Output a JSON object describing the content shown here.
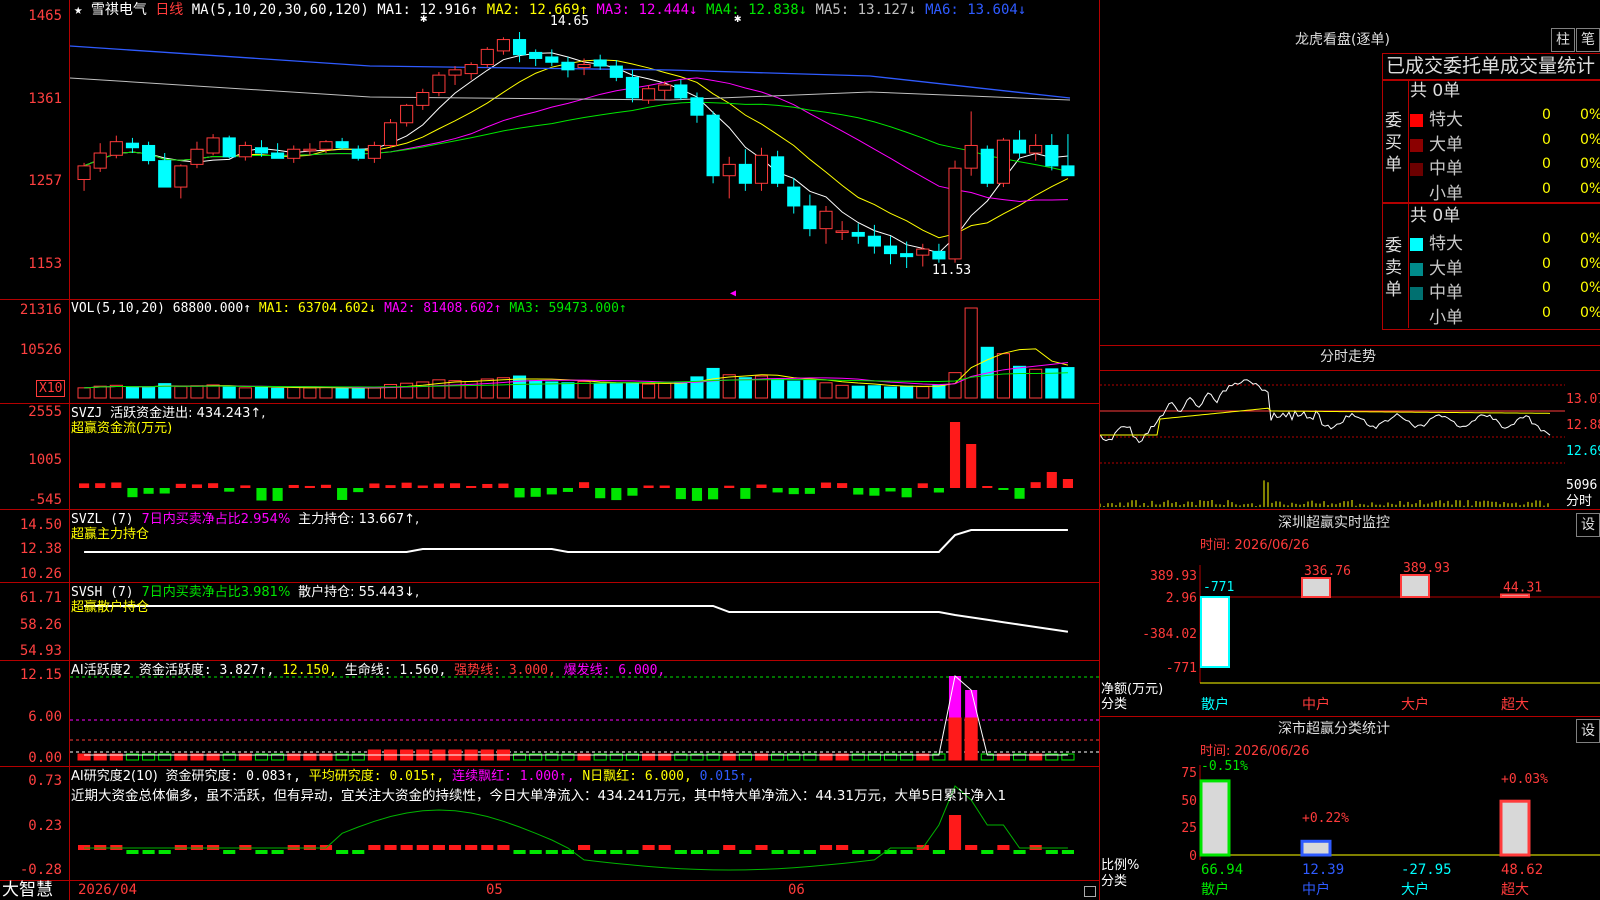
{
  "app": {
    "brand": "大智慧"
  },
  "stock": {
    "star": "★",
    "name": "雪祺电气",
    "period": "日线"
  },
  "main_chart": {
    "ma_header": "MA(5,10,20,30,60,120)",
    "ma_items": [
      {
        "label": "MA1: 12.916↑",
        "color": "#ffffff"
      },
      {
        "label": "MA2: 12.669↑",
        "color": "#ffff00"
      },
      {
        "label": "MA3: 12.444↓",
        "color": "#ff00ff"
      },
      {
        "label": "MA4: 12.838↓",
        "color": "#00e600"
      },
      {
        "label": "MA5: 13.127↓",
        "color": "#c0c0c0"
      },
      {
        "label": "MA6: 13.604↓",
        "color": "#2f5bff"
      }
    ],
    "y_ticks": [
      "1465",
      "1361",
      "1257",
      "1153"
    ],
    "high_label": "14.65",
    "low_label": "11.53",
    "candles": [
      [
        12.7,
        12.92,
        12.55,
        12.88
      ],
      [
        12.85,
        13.18,
        12.8,
        13.05
      ],
      [
        13.02,
        13.28,
        12.98,
        13.2
      ],
      [
        13.18,
        13.25,
        13.05,
        13.12
      ],
      [
        13.15,
        13.2,
        12.9,
        12.95
      ],
      [
        12.95,
        13.05,
        12.65,
        12.6
      ],
      [
        12.6,
        12.9,
        12.45,
        12.88
      ],
      [
        12.9,
        13.2,
        12.85,
        13.1
      ],
      [
        13.05,
        13.3,
        13.02,
        13.25
      ],
      [
        13.25,
        13.28,
        12.98,
        13.0
      ],
      [
        13.0,
        13.2,
        12.95,
        13.15
      ],
      [
        13.12,
        13.22,
        13.0,
        13.05
      ],
      [
        13.05,
        13.18,
        12.98,
        12.98
      ],
      [
        12.98,
        13.15,
        12.92,
        13.1
      ],
      [
        13.08,
        13.18,
        13.02,
        13.1
      ],
      [
        13.1,
        13.22,
        13.05,
        13.2
      ],
      [
        13.2,
        13.25,
        13.1,
        13.12
      ],
      [
        13.1,
        13.15,
        12.95,
        12.98
      ],
      [
        12.98,
        13.2,
        12.92,
        13.15
      ],
      [
        13.15,
        13.5,
        13.12,
        13.45
      ],
      [
        13.45,
        13.7,
        13.4,
        13.68
      ],
      [
        13.68,
        13.9,
        13.62,
        13.85
      ],
      [
        13.85,
        14.12,
        13.8,
        14.08
      ],
      [
        14.08,
        14.2,
        13.95,
        14.15
      ],
      [
        14.1,
        14.25,
        14.02,
        14.22
      ],
      [
        14.22,
        14.45,
        14.18,
        14.42
      ],
      [
        14.4,
        14.58,
        14.35,
        14.55
      ],
      [
        14.55,
        14.65,
        14.25,
        14.35
      ],
      [
        14.38,
        14.42,
        14.2,
        14.3
      ],
      [
        14.32,
        14.42,
        14.2,
        14.25
      ],
      [
        14.25,
        14.32,
        14.05,
        14.15
      ],
      [
        14.18,
        14.3,
        14.08,
        14.22
      ],
      [
        14.28,
        14.35,
        14.15,
        14.2
      ],
      [
        14.2,
        14.28,
        14.0,
        14.05
      ],
      [
        14.05,
        14.15,
        13.72,
        13.78
      ],
      [
        13.75,
        13.95,
        13.7,
        13.9
      ],
      [
        13.88,
        14.0,
        13.75,
        13.95
      ],
      [
        13.95,
        14.02,
        13.75,
        13.78
      ],
      [
        13.78,
        13.85,
        13.45,
        13.55
      ],
      [
        13.55,
        13.6,
        12.65,
        12.75
      ],
      [
        12.75,
        13.0,
        12.45,
        12.9
      ],
      [
        12.9,
        13.1,
        12.55,
        12.65
      ],
      [
        12.65,
        13.12,
        12.55,
        13.02
      ],
      [
        13.0,
        13.08,
        12.6,
        12.65
      ],
      [
        12.6,
        12.72,
        12.25,
        12.35
      ],
      [
        12.35,
        12.5,
        11.95,
        12.05
      ],
      [
        12.05,
        12.35,
        11.85,
        12.28
      ],
      [
        12.0,
        12.15,
        11.9,
        12.02
      ],
      [
        12.0,
        12.12,
        11.85,
        11.95
      ],
      [
        11.95,
        12.1,
        11.72,
        11.82
      ],
      [
        11.82,
        11.95,
        11.58,
        11.72
      ],
      [
        11.72,
        11.88,
        11.53,
        11.68
      ],
      [
        11.7,
        11.85,
        11.55,
        11.78
      ],
      [
        11.75,
        11.85,
        11.6,
        11.65
      ],
      [
        11.65,
        12.95,
        11.6,
        12.85
      ],
      [
        12.85,
        13.6,
        12.75,
        13.15
      ],
      [
        13.1,
        13.15,
        12.6,
        12.65
      ],
      [
        12.65,
        13.25,
        12.6,
        13.22
      ],
      [
        13.22,
        13.35,
        12.98,
        13.05
      ],
      [
        13.05,
        13.3,
        12.95,
        13.15
      ],
      [
        13.15,
        13.3,
        12.82,
        12.88
      ],
      [
        12.88,
        13.3,
        12.8,
        12.75
      ]
    ]
  },
  "vol_pane": {
    "header": "VOL(5,10,20)",
    "items": [
      {
        "label": "68800.000↑",
        "color": "#ffffff"
      },
      {
        "label": "MA1: 63704.602↓",
        "color": "#ffff00"
      },
      {
        "label": "MA2: 81408.602↑",
        "color": "#ff00ff"
      },
      {
        "label": "MA3: 59473.000↑",
        "color": "#00e600"
      }
    ],
    "y_ticks": [
      "21316",
      "10526"
    ],
    "unit": "X10",
    "values": [
      2.4,
      2.8,
      3.0,
      2.6,
      2.5,
      3.4,
      2.7,
      2.9,
      3.1,
      2.6,
      2.4,
      2.5,
      2.3,
      2.6,
      2.4,
      2.5,
      2.3,
      2.2,
      2.4,
      3.2,
      3.5,
      3.8,
      4.3,
      4.1,
      3.9,
      4.5,
      4.8,
      5.2,
      4.1,
      3.8,
      3.6,
      3.9,
      3.5,
      3.4,
      3.6,
      3.3,
      3.5,
      3.8,
      5.0,
      7.0,
      5.5,
      4.8,
      5.2,
      4.4,
      4.0,
      4.3,
      3.6,
      3.0,
      2.8,
      2.9,
      2.6,
      2.8,
      2.7,
      3.1,
      6.0,
      21.3,
      12.0,
      10.5,
      7.5,
      6.8,
      6.9,
      7.2
    ]
  },
  "svzj_pane": {
    "title": "SVZJ",
    "item": "活跃资金进出: 434.243↑,",
    "subtitle": "超赢资金流(万元)",
    "y_ticks": [
      "2555",
      "1005",
      "-545"
    ]
  },
  "svzl_pane": {
    "title": "SVZL (7)",
    "ratio": "7日内买卖净占比2.954%",
    "item": "主力持仓: 13.667↑,",
    "subtitle": "超赢主力持仓",
    "y_ticks": [
      "14.50",
      "12.38",
      "10.26"
    ]
  },
  "svsh_pane": {
    "title": "SVSH (7)",
    "ratio": "7日内买卖净占比3.981%",
    "item": "散户持仓: 55.443↓,",
    "subtitle": "超赢散户持仓",
    "y_ticks": [
      "61.71",
      "58.26",
      "54.93"
    ]
  },
  "ai_act_pane": {
    "title": "AI活跃度2",
    "items": [
      {
        "label": "资金活跃度: 3.827↑,",
        "color": "#ffffff"
      },
      {
        "label": "12.150,",
        "color": "#ffff00"
      },
      {
        "label": "生命线: 1.560,",
        "color": "#ffffff"
      },
      {
        "label": "强势线: 3.000,",
        "color": "#ff3b3b"
      },
      {
        "label": "爆发线: 6.000,",
        "color": "#ff00ff"
      }
    ],
    "y_ticks": [
      "12.15",
      "6.00",
      "0.00"
    ]
  },
  "ai_res_pane": {
    "title": "AI研究度2(10)",
    "items": [
      {
        "label": "资金研究度: 0.083↑,",
        "color": "#ffffff"
      },
      {
        "label": "平均研究度: 0.015↑,",
        "color": "#ffff00"
      },
      {
        "label": "连续飘红: 1.000↑,",
        "color": "#ff00ff"
      },
      {
        "label": "N日飘红: 6.000,",
        "color": "#ffff00"
      },
      {
        "label": "0.015↑,",
        "color": "#2f5bff"
      }
    ],
    "comment": "近期大资金总体偏多，虽不活跃，但有异动，宜关注大资金的持续性，今日大单净流入：434.241万元，其中特大单净流入：44.31万元，大单5日累计净入1",
    "y_ticks": [
      "0.73",
      "0.23",
      "-0.28"
    ]
  },
  "x_axis": {
    "labels": [
      "2026/04",
      "05",
      "06"
    ]
  },
  "dragon_tiger": {
    "title": "龙虎看盘(逐单)",
    "btn1": "柱",
    "btn2": "笔",
    "subtitle": "已成交委托单成交量统计",
    "buy_side_label": "委买单",
    "sell_side_label": "委卖单",
    "buy_total": "共 0单",
    "sell_total": "共 0单",
    "buy_rows": [
      {
        "label": "特大",
        "value": "0",
        "pct": "0%",
        "color": "#ff0000"
      },
      {
        "label": "大单",
        "value": "0",
        "pct": "0%",
        "color": "#8b0000"
      },
      {
        "label": "中单",
        "value": "0",
        "pct": "0%",
        "color": "#6b0000"
      },
      {
        "label": "小单",
        "value": "0",
        "pct": "0%",
        "color": "#000000"
      }
    ],
    "sell_rows": [
      {
        "label": "特大",
        "value": "0",
        "pct": "0%",
        "color": "#00ffff"
      },
      {
        "label": "大单",
        "value": "0",
        "pct": "0%",
        "color": "#008b8b"
      },
      {
        "label": "中单",
        "value": "0",
        "pct": "0%",
        "color": "#007070"
      },
      {
        "label": "小单",
        "value": "0",
        "pct": "0%",
        "color": "#000000"
      }
    ]
  },
  "intraday": {
    "title": "分时走势",
    "y_ticks": [
      "13.07",
      "12.88",
      "12.69"
    ],
    "vol_label": "5096",
    "footer": "分时"
  },
  "sz_monitor": {
    "title": "深圳超赢实时监控",
    "btn": "设",
    "time": "时间: 2026/06/26",
    "y_ticks": [
      "389.93",
      "2.96",
      "-384.02",
      "-771"
    ],
    "ylabel1": "净额(万元)",
    "ylabel2": "分类",
    "categories": [
      "散户",
      "中户",
      "大户",
      "超大"
    ],
    "values": [
      -771,
      336.76,
      389.93,
      44.31
    ],
    "value_labels": [
      "-771",
      "336.76",
      "389.93",
      "44.31"
    ]
  },
  "sz_class": {
    "title": "深市超赢分类统计",
    "btn": "设",
    "time": "时间: 2026/06/26",
    "y_ticks": [
      "75",
      "50",
      "25",
      "0"
    ],
    "ylabel1": "比例%",
    "ylabel2": "分类",
    "categories": [
      "散户",
      "中户",
      "大户",
      "超大"
    ],
    "values": [
      66.94,
      12.39,
      -27.95,
      48.62
    ],
    "top_labels": [
      "-0.51%",
      "+0.22%",
      "",
      "+0.03%"
    ],
    "bottom_labels": [
      "66.94",
      "12.39",
      "-27.95",
      "48.62"
    ]
  }
}
